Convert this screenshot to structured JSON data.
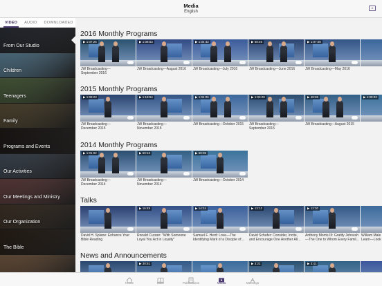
{
  "header": {
    "title": "Media",
    "subtitle": "English",
    "language_button": "A"
  },
  "sidebar": {
    "tabs": [
      {
        "label": "VIDEO",
        "active": true
      },
      {
        "label": "AUDIO",
        "active": false
      },
      {
        "label": "DOWNLOADED",
        "active": false
      }
    ],
    "categories": [
      {
        "label": "From Our Studio",
        "active": true,
        "color": "#3a3f4a"
      },
      {
        "label": "Children",
        "active": false,
        "color": "#7fb1cf"
      },
      {
        "label": "Teenagers",
        "active": false,
        "color": "#6f8a5a"
      },
      {
        "label": "Family",
        "active": false,
        "color": "#7a6a4a"
      },
      {
        "label": "Programs and Events",
        "active": false,
        "color": "#2a2320"
      },
      {
        "label": "Our Activities",
        "active": false,
        "color": "#5d6a7a"
      },
      {
        "label": "Our Meetings and Ministry",
        "active": false,
        "color": "#8c5a5a"
      },
      {
        "label": "Our Organization",
        "active": false,
        "color": "#5a4a3a"
      },
      {
        "label": "The Bible",
        "active": false,
        "color": "#3b2e22"
      },
      {
        "label": "",
        "active": false,
        "color": "#a07a5a"
      }
    ]
  },
  "sections": [
    {
      "title": "2016 Monthly Programs",
      "items": [
        {
          "duration": "1:07:26",
          "caption": "JW Broadcasting—\nSeptember 2016",
          "people": 2
        },
        {
          "duration": "1:08:53",
          "caption": "JW Broadcasting—August 2016",
          "people": 1
        },
        {
          "duration": "1:04:42",
          "caption": "JW Broadcasting—July 2016",
          "people": 2
        },
        {
          "duration": "58:46",
          "caption": "JW Broadcasting—June 2016",
          "people": 2
        },
        {
          "duration": "1:07:08",
          "caption": "JW Broadcasting—May 2016",
          "people": 1
        },
        {
          "duration": "",
          "caption": "",
          "people": 1
        }
      ]
    },
    {
      "title": "2015 Monthly Programs",
      "items": [
        {
          "duration": "1:08:23",
          "caption": "JW Broadcasting—\nDecember 2015",
          "people": 1
        },
        {
          "duration": "1:18:54",
          "caption": "JW Broadcasting—\nNovember 2015",
          "people": 1
        },
        {
          "duration": "1:04:06",
          "caption": "JW Broadcasting—October 2015",
          "people": 2
        },
        {
          "duration": "1:03:28",
          "caption": "JW Broadcasting—\nSeptember 2015",
          "people": 2
        },
        {
          "duration": "48:36",
          "caption": "JW Broadcasting—August 2015",
          "people": 2
        },
        {
          "duration": "1:09:03",
          "caption": "",
          "people": 1
        }
      ]
    },
    {
      "title": "2014 Monthly Programs",
      "items": [
        {
          "duration": "1:01:02",
          "caption": "JW Broadcasting—\nDecember 2014",
          "people": 2
        },
        {
          "duration": "50:13",
          "caption": "JW Broadcasting—\nNovember 2014",
          "people": 1
        },
        {
          "duration": "58:05",
          "caption": "JW Broadcasting—October 2014",
          "people": 1
        }
      ]
    },
    {
      "title": "Talks",
      "items": [
        {
          "duration": "",
          "caption": "David H. Splane: Enhance Your\nBible Reading",
          "people": 1
        },
        {
          "duration": "16:49",
          "caption": "Ronald Curzan: \"With Someone\nLoyal You Act in Loyalty\"",
          "people": 1
        },
        {
          "duration": "14:24",
          "caption": "Samuel F. Herd: Love—The\nIdentifying Mark of a Disciple of...",
          "people": 1
        },
        {
          "duration": "13:12",
          "caption": "David Schafer: Consider, Incite,\nand Encourage One Another All...",
          "people": 1
        },
        {
          "duration": "12:30",
          "caption": "Anthony Morris III: Gratify Jehovah\n—The One to Whom Every Famil...",
          "people": 1
        },
        {
          "duration": "",
          "caption": "William Male\nLearn—Look",
          "people": 1
        }
      ]
    },
    {
      "title": "News and Announcements",
      "items": [
        {
          "duration": "",
          "caption": "",
          "people": 1
        },
        {
          "duration": "30:51",
          "caption": "",
          "people": 1
        },
        {
          "duration": "",
          "caption": "",
          "people": 1
        },
        {
          "duration": "3:22",
          "caption": "",
          "people": 1
        },
        {
          "duration": "3:41",
          "caption": "",
          "people": 1
        },
        {
          "duration": "",
          "caption": "",
          "people": 1
        }
      ]
    }
  ],
  "tabbar": {
    "items": [
      {
        "label": "Home",
        "icon": "home-icon",
        "active": false
      },
      {
        "label": "Bible",
        "icon": "bible-icon",
        "active": false
      },
      {
        "label": "Publications",
        "icon": "publications-icon",
        "active": false
      },
      {
        "label": "Media",
        "icon": "media-icon",
        "active": true
      },
      {
        "label": "Meetings",
        "icon": "meetings-icon",
        "active": false
      }
    ]
  },
  "colors": {
    "accent": "#4a3a70",
    "background": "#f2f2f2"
  }
}
